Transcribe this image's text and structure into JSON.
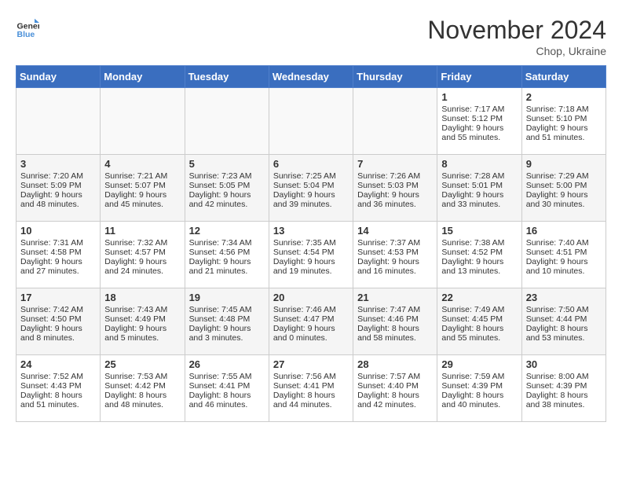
{
  "logo": {
    "line1": "General",
    "line2": "Blue"
  },
  "title": "November 2024",
  "subtitle": "Chop, Ukraine",
  "days_of_week": [
    "Sunday",
    "Monday",
    "Tuesday",
    "Wednesday",
    "Thursday",
    "Friday",
    "Saturday"
  ],
  "weeks": [
    [
      {
        "day": "",
        "sunrise": "",
        "sunset": "",
        "daylight": ""
      },
      {
        "day": "",
        "sunrise": "",
        "sunset": "",
        "daylight": ""
      },
      {
        "day": "",
        "sunrise": "",
        "sunset": "",
        "daylight": ""
      },
      {
        "day": "",
        "sunrise": "",
        "sunset": "",
        "daylight": ""
      },
      {
        "day": "",
        "sunrise": "",
        "sunset": "",
        "daylight": ""
      },
      {
        "day": "1",
        "sunrise": "Sunrise: 7:17 AM",
        "sunset": "Sunset: 5:12 PM",
        "daylight": "Daylight: 9 hours and 55 minutes."
      },
      {
        "day": "2",
        "sunrise": "Sunrise: 7:18 AM",
        "sunset": "Sunset: 5:10 PM",
        "daylight": "Daylight: 9 hours and 51 minutes."
      }
    ],
    [
      {
        "day": "3",
        "sunrise": "Sunrise: 7:20 AM",
        "sunset": "Sunset: 5:09 PM",
        "daylight": "Daylight: 9 hours and 48 minutes."
      },
      {
        "day": "4",
        "sunrise": "Sunrise: 7:21 AM",
        "sunset": "Sunset: 5:07 PM",
        "daylight": "Daylight: 9 hours and 45 minutes."
      },
      {
        "day": "5",
        "sunrise": "Sunrise: 7:23 AM",
        "sunset": "Sunset: 5:05 PM",
        "daylight": "Daylight: 9 hours and 42 minutes."
      },
      {
        "day": "6",
        "sunrise": "Sunrise: 7:25 AM",
        "sunset": "Sunset: 5:04 PM",
        "daylight": "Daylight: 9 hours and 39 minutes."
      },
      {
        "day": "7",
        "sunrise": "Sunrise: 7:26 AM",
        "sunset": "Sunset: 5:03 PM",
        "daylight": "Daylight: 9 hours and 36 minutes."
      },
      {
        "day": "8",
        "sunrise": "Sunrise: 7:28 AM",
        "sunset": "Sunset: 5:01 PM",
        "daylight": "Daylight: 9 hours and 33 minutes."
      },
      {
        "day": "9",
        "sunrise": "Sunrise: 7:29 AM",
        "sunset": "Sunset: 5:00 PM",
        "daylight": "Daylight: 9 hours and 30 minutes."
      }
    ],
    [
      {
        "day": "10",
        "sunrise": "Sunrise: 7:31 AM",
        "sunset": "Sunset: 4:58 PM",
        "daylight": "Daylight: 9 hours and 27 minutes."
      },
      {
        "day": "11",
        "sunrise": "Sunrise: 7:32 AM",
        "sunset": "Sunset: 4:57 PM",
        "daylight": "Daylight: 9 hours and 24 minutes."
      },
      {
        "day": "12",
        "sunrise": "Sunrise: 7:34 AM",
        "sunset": "Sunset: 4:56 PM",
        "daylight": "Daylight: 9 hours and 21 minutes."
      },
      {
        "day": "13",
        "sunrise": "Sunrise: 7:35 AM",
        "sunset": "Sunset: 4:54 PM",
        "daylight": "Daylight: 9 hours and 19 minutes."
      },
      {
        "day": "14",
        "sunrise": "Sunrise: 7:37 AM",
        "sunset": "Sunset: 4:53 PM",
        "daylight": "Daylight: 9 hours and 16 minutes."
      },
      {
        "day": "15",
        "sunrise": "Sunrise: 7:38 AM",
        "sunset": "Sunset: 4:52 PM",
        "daylight": "Daylight: 9 hours and 13 minutes."
      },
      {
        "day": "16",
        "sunrise": "Sunrise: 7:40 AM",
        "sunset": "Sunset: 4:51 PM",
        "daylight": "Daylight: 9 hours and 10 minutes."
      }
    ],
    [
      {
        "day": "17",
        "sunrise": "Sunrise: 7:42 AM",
        "sunset": "Sunset: 4:50 PM",
        "daylight": "Daylight: 9 hours and 8 minutes."
      },
      {
        "day": "18",
        "sunrise": "Sunrise: 7:43 AM",
        "sunset": "Sunset: 4:49 PM",
        "daylight": "Daylight: 9 hours and 5 minutes."
      },
      {
        "day": "19",
        "sunrise": "Sunrise: 7:45 AM",
        "sunset": "Sunset: 4:48 PM",
        "daylight": "Daylight: 9 hours and 3 minutes."
      },
      {
        "day": "20",
        "sunrise": "Sunrise: 7:46 AM",
        "sunset": "Sunset: 4:47 PM",
        "daylight": "Daylight: 9 hours and 0 minutes."
      },
      {
        "day": "21",
        "sunrise": "Sunrise: 7:47 AM",
        "sunset": "Sunset: 4:46 PM",
        "daylight": "Daylight: 8 hours and 58 minutes."
      },
      {
        "day": "22",
        "sunrise": "Sunrise: 7:49 AM",
        "sunset": "Sunset: 4:45 PM",
        "daylight": "Daylight: 8 hours and 55 minutes."
      },
      {
        "day": "23",
        "sunrise": "Sunrise: 7:50 AM",
        "sunset": "Sunset: 4:44 PM",
        "daylight": "Daylight: 8 hours and 53 minutes."
      }
    ],
    [
      {
        "day": "24",
        "sunrise": "Sunrise: 7:52 AM",
        "sunset": "Sunset: 4:43 PM",
        "daylight": "Daylight: 8 hours and 51 minutes."
      },
      {
        "day": "25",
        "sunrise": "Sunrise: 7:53 AM",
        "sunset": "Sunset: 4:42 PM",
        "daylight": "Daylight: 8 hours and 48 minutes."
      },
      {
        "day": "26",
        "sunrise": "Sunrise: 7:55 AM",
        "sunset": "Sunset: 4:41 PM",
        "daylight": "Daylight: 8 hours and 46 minutes."
      },
      {
        "day": "27",
        "sunrise": "Sunrise: 7:56 AM",
        "sunset": "Sunset: 4:41 PM",
        "daylight": "Daylight: 8 hours and 44 minutes."
      },
      {
        "day": "28",
        "sunrise": "Sunrise: 7:57 AM",
        "sunset": "Sunset: 4:40 PM",
        "daylight": "Daylight: 8 hours and 42 minutes."
      },
      {
        "day": "29",
        "sunrise": "Sunrise: 7:59 AM",
        "sunset": "Sunset: 4:39 PM",
        "daylight": "Daylight: 8 hours and 40 minutes."
      },
      {
        "day": "30",
        "sunrise": "Sunrise: 8:00 AM",
        "sunset": "Sunset: 4:39 PM",
        "daylight": "Daylight: 8 hours and 38 minutes."
      }
    ]
  ]
}
